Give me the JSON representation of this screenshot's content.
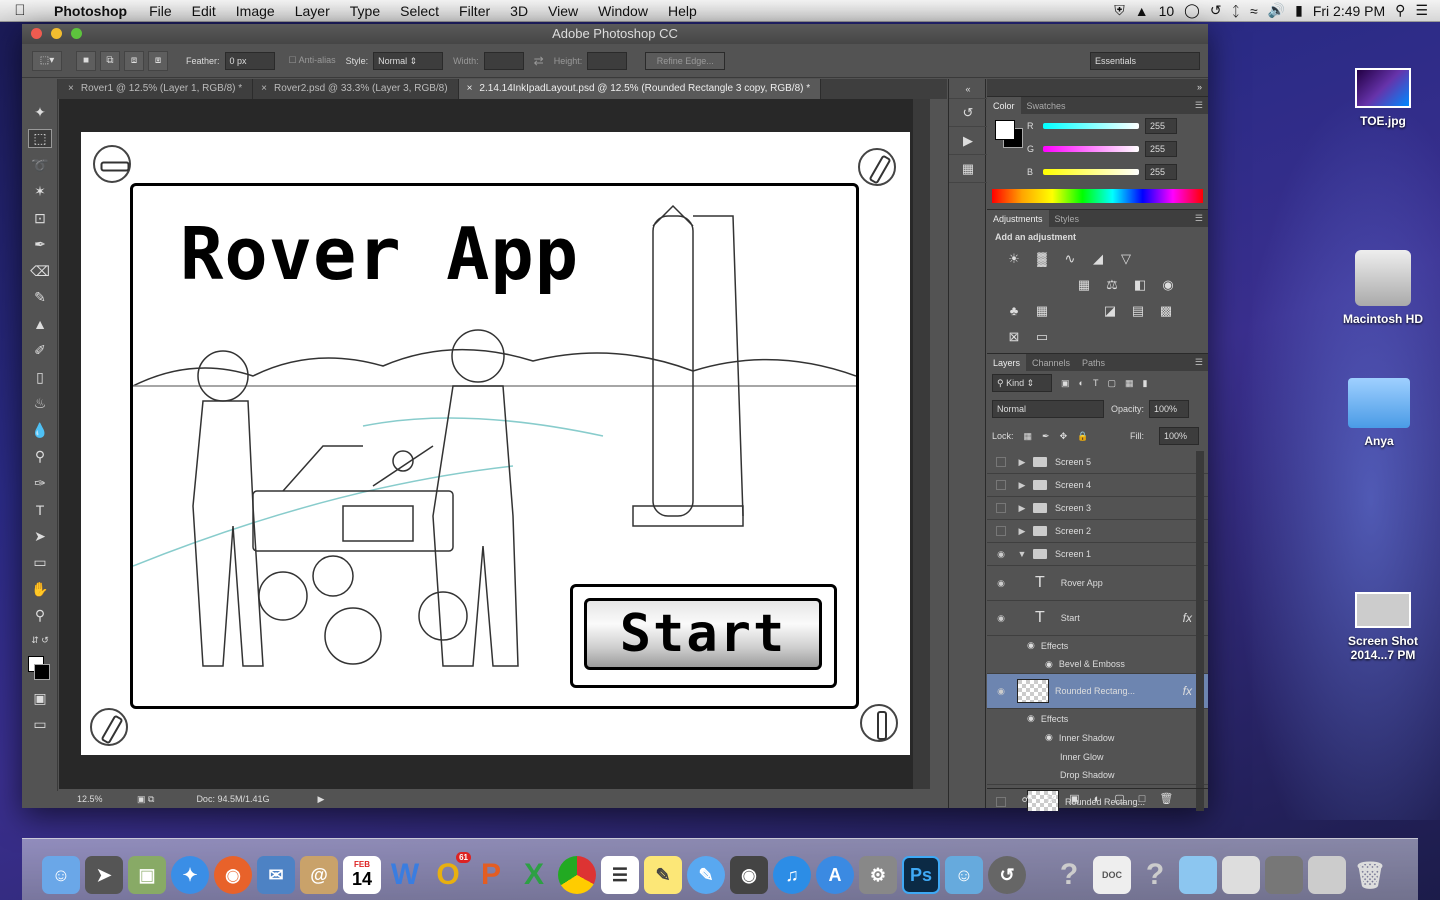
{
  "menubar": {
    "app": "Photoshop",
    "items": [
      "File",
      "Edit",
      "Image",
      "Layer",
      "Type",
      "Select",
      "Filter",
      "3D",
      "View",
      "Window",
      "Help"
    ],
    "status_num": "10",
    "clock": "Fri 2:49 PM"
  },
  "window": {
    "title": "Adobe Photoshop CC"
  },
  "options": {
    "feather_label": "Feather:",
    "feather_value": "0 px",
    "antialias": "Anti-alias",
    "style_label": "Style:",
    "style_value": "Normal",
    "width_label": "Width:",
    "height_label": "Height:",
    "refine": "Refine Edge...",
    "workspace": "Essentials"
  },
  "tabs": [
    "Rover1 @ 12.5% (Layer 1, RGB/8) *",
    "Rover2.psd @ 33.3% (Layer 3, RGB/8)",
    "2.14.14InkIpadLayout.psd @ 12.5% (Rounded Rectangle 3 copy, RGB/8) *"
  ],
  "canvas": {
    "title": "Rover App",
    "start": "Start"
  },
  "status": {
    "zoom": "12.5%",
    "doc": "Doc: 94.5M/1.41G"
  },
  "color": {
    "tabs": [
      "Color",
      "Swatches"
    ],
    "r_label": "R",
    "g_label": "G",
    "b_label": "B",
    "r": "255",
    "g": "255",
    "b": "255"
  },
  "adjustments": {
    "tabs": [
      "Adjustments",
      "Styles"
    ],
    "heading": "Add an adjustment"
  },
  "layers": {
    "tabs": [
      "Layers",
      "Channels",
      "Paths"
    ],
    "kind": "Kind",
    "blend": "Normal",
    "opacity_label": "Opacity:",
    "opacity": "100%",
    "lock_label": "Lock:",
    "fill_label": "Fill:",
    "fill": "100%",
    "rows": [
      "Screen 5",
      "Screen 4",
      "Screen 3",
      "Screen 2",
      "Screen 1",
      "Rover App",
      "Start",
      "Effects",
      "Bevel & Emboss",
      "Rounded Rectang...",
      "Effects",
      "Inner Shadow",
      "Inner Glow",
      "Drop Shadow",
      "Rounded Rectang..."
    ]
  },
  "desktop": {
    "icons": [
      "TOE.jpg",
      "Macintosh HD",
      "Anya",
      "Screen Shot 2014...7 PM"
    ]
  },
  "dock": {
    "badge": "61",
    "cal_day": "14",
    "cal_month": "FEB"
  }
}
